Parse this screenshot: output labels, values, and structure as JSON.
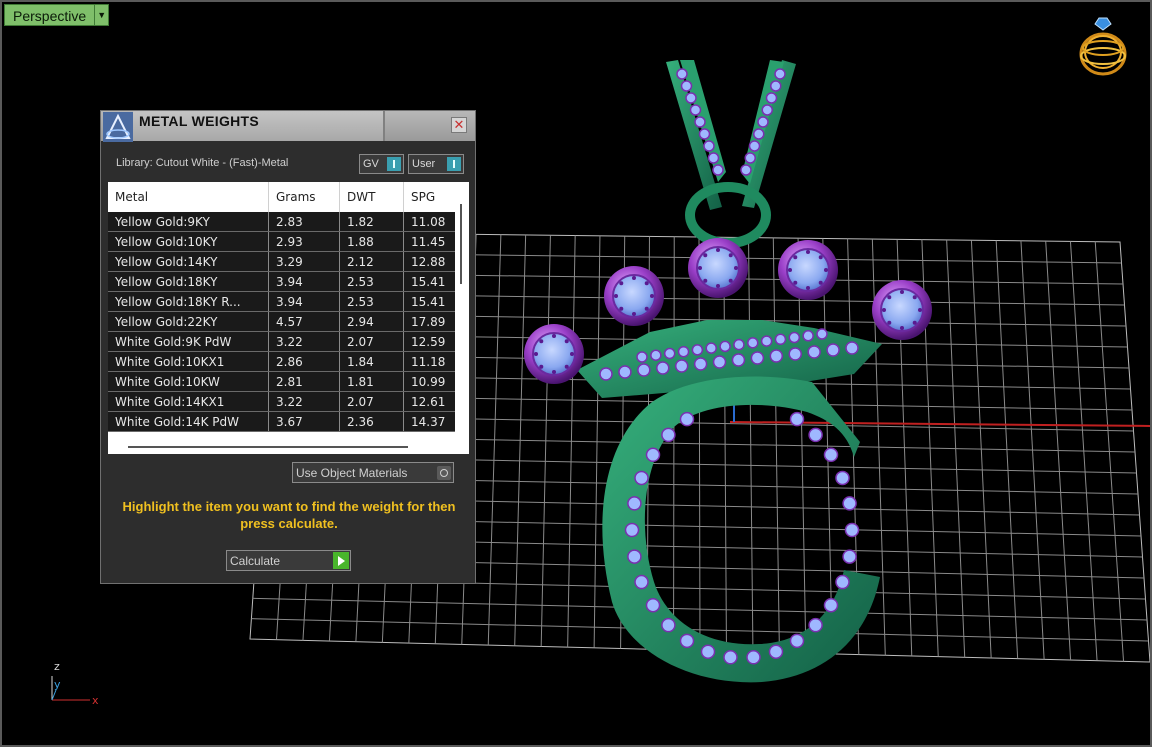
{
  "viewport": {
    "view_label": "Perspective",
    "axis": {
      "z": "z",
      "y": "y",
      "x": "x"
    }
  },
  "panel": {
    "title": "METAL WEIGHTS",
    "library": "Library: Cutout White - (Fast)-Metal",
    "toggles": {
      "gv": "GV",
      "user": "User"
    },
    "columns": [
      "Metal",
      "Grams",
      "DWT",
      "SPG"
    ],
    "rows": [
      [
        "Yellow Gold:9KY",
        "2.83",
        "1.82",
        "11.08"
      ],
      [
        "Yellow Gold:10KY",
        "2.93",
        "1.88",
        "11.45"
      ],
      [
        "Yellow Gold:14KY",
        "3.29",
        "2.12",
        "12.88"
      ],
      [
        "Yellow Gold:18KY",
        "3.94",
        "2.53",
        "15.41"
      ],
      [
        "Yellow Gold:18KY R...",
        "3.94",
        "2.53",
        "15.41"
      ],
      [
        "Yellow Gold:22KY",
        "4.57",
        "2.94",
        "17.89"
      ],
      [
        "White Gold:9K PdW",
        "3.22",
        "2.07",
        "12.59"
      ],
      [
        "White Gold:10KX1",
        "2.86",
        "1.84",
        "11.18"
      ],
      [
        "White Gold:10KW",
        "2.81",
        "1.81",
        "10.99"
      ],
      [
        "White Gold:14KX1",
        "3.22",
        "2.07",
        "12.61"
      ],
      [
        "White Gold:14K PdW",
        "3.67",
        "2.36",
        "14.37"
      ]
    ],
    "use_object_materials": "Use Object Materials",
    "hint": "Highlight the item you want to find the weight for then press calculate.",
    "calculate_label": "Calculate"
  },
  "colors": {
    "metal_green": "#1f8a5f",
    "stone_blue": "#8aa8f0",
    "bezel_purple": "#9a3fc8",
    "hint_yellow": "#f0c020",
    "perspective_green": "#7fbf6a"
  }
}
